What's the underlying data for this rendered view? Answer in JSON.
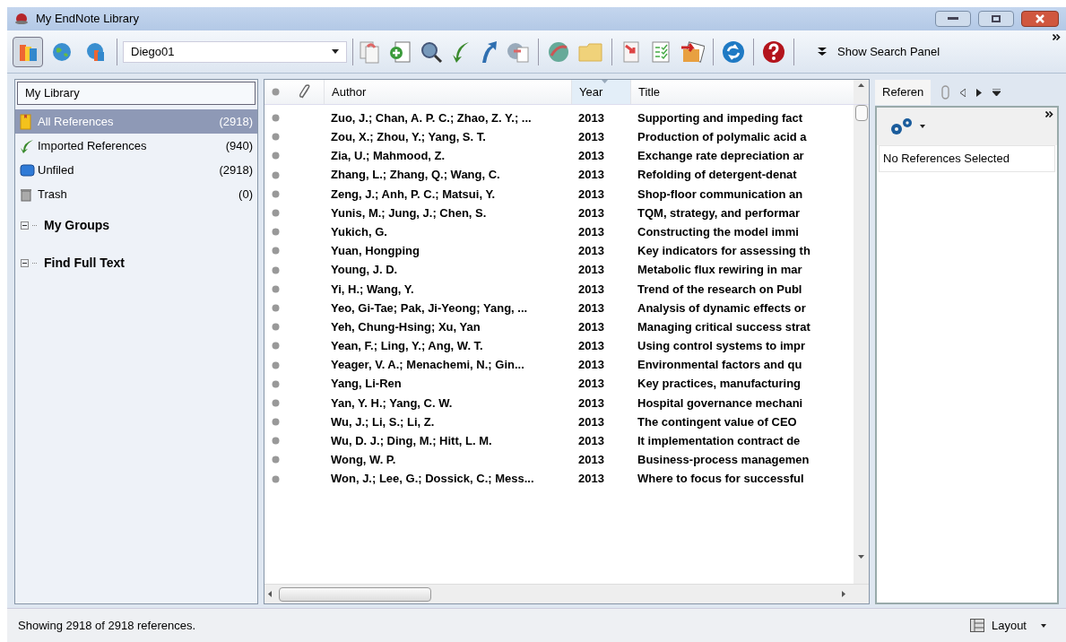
{
  "window": {
    "title": "My EndNote Library"
  },
  "toolbar": {
    "modes": [
      {
        "selected": true
      },
      {
        "selected": false
      },
      {
        "selected": false
      }
    ],
    "style_value": "Diego01",
    "search_panel_button": "Show Search Panel"
  },
  "sidebar": {
    "header": "My Library",
    "items": [
      {
        "kind": "group",
        "label": "All References",
        "count": "(2918)",
        "selected": true
      },
      {
        "kind": "imported",
        "label": "Imported References",
        "count": "(940)",
        "selected": false
      },
      {
        "kind": "unfiled",
        "label": "Unfiled",
        "count": "(2918)",
        "selected": false
      },
      {
        "kind": "trash",
        "label": "Trash",
        "count": "(0)",
        "selected": false
      },
      {
        "kind": "heading",
        "label": "My Groups",
        "expanded": true
      },
      {
        "kind": "heading",
        "label": "Find Full Text",
        "expanded": true
      }
    ]
  },
  "table": {
    "columns": [
      {
        "label": "Author",
        "sorted": false
      },
      {
        "label": "Year",
        "sorted": true
      },
      {
        "label": "Title",
        "sorted": false
      }
    ],
    "rows": [
      {
        "author": "Zuo, J.; Chan, A. P. C.; Zhao, Z. Y.; ...",
        "year": "2013",
        "title": "Supporting and impeding fact"
      },
      {
        "author": "Zou, X.; Zhou, Y.; Yang, S. T.",
        "year": "2013",
        "title": "Production of polymalic acid a"
      },
      {
        "author": "Zia, U.; Mahmood, Z.",
        "year": "2013",
        "title": "Exchange rate depreciation ar"
      },
      {
        "author": "Zhang, L.; Zhang, Q.; Wang, C.",
        "year": "2013",
        "title": "Refolding of detergent-denat"
      },
      {
        "author": "Zeng, J.; Anh, P. C.; Matsui, Y.",
        "year": "2013",
        "title": "Shop-floor communication an"
      },
      {
        "author": "Yunis, M.; Jung, J.; Chen, S.",
        "year": "2013",
        "title": "TQM, strategy, and performar"
      },
      {
        "author": "Yukich, G.",
        "year": "2013",
        "title": "Constructing the model immi"
      },
      {
        "author": "Yuan, Hongping",
        "year": "2013",
        "title": "Key indicators for assessing th"
      },
      {
        "author": "Young, J. D.",
        "year": "2013",
        "title": "Metabolic flux rewiring in mar"
      },
      {
        "author": "Yi, H.; Wang, Y.",
        "year": "2013",
        "title": "Trend of the research on Publ"
      },
      {
        "author": "Yeo, Gi-Tae; Pak, Ji-Yeong; Yang, ...",
        "year": "2013",
        "title": "Analysis of dynamic effects or"
      },
      {
        "author": "Yeh, Chung-Hsing; Xu, Yan",
        "year": "2013",
        "title": "Managing critical success strat"
      },
      {
        "author": "Yean, F.; Ling, Y.; Ang, W. T.",
        "year": "2013",
        "title": "Using control systems to impr"
      },
      {
        "author": "Yeager, V. A.; Menachemi, N.; Gin...",
        "year": "2013",
        "title": "Environmental factors and qu"
      },
      {
        "author": "Yang, Li-Ren",
        "year": "2013",
        "title": "Key practices, manufacturing"
      },
      {
        "author": "Yan, Y. H.; Yang, C. W.",
        "year": "2013",
        "title": "Hospital governance mechani"
      },
      {
        "author": "Wu, J.; Li, S.; Li, Z.",
        "year": "2013",
        "title": "The contingent value of CEO"
      },
      {
        "author": "Wu, D. J.; Ding, M.; Hitt, L. M.",
        "year": "2013",
        "title": "It implementation contract de"
      },
      {
        "author": "Wong, W. P.",
        "year": "2013",
        "title": "Business-process managemen"
      },
      {
        "author": "Won, J.; Lee, G.; Dossick, C.; Mess...",
        "year": "2013",
        "title": "Where to focus for successful"
      }
    ]
  },
  "preview": {
    "tab": "Referen",
    "message": "No References Selected"
  },
  "status_bar": {
    "text": "Showing 2918 of 2918 references.",
    "layout_button": "Layout"
  }
}
